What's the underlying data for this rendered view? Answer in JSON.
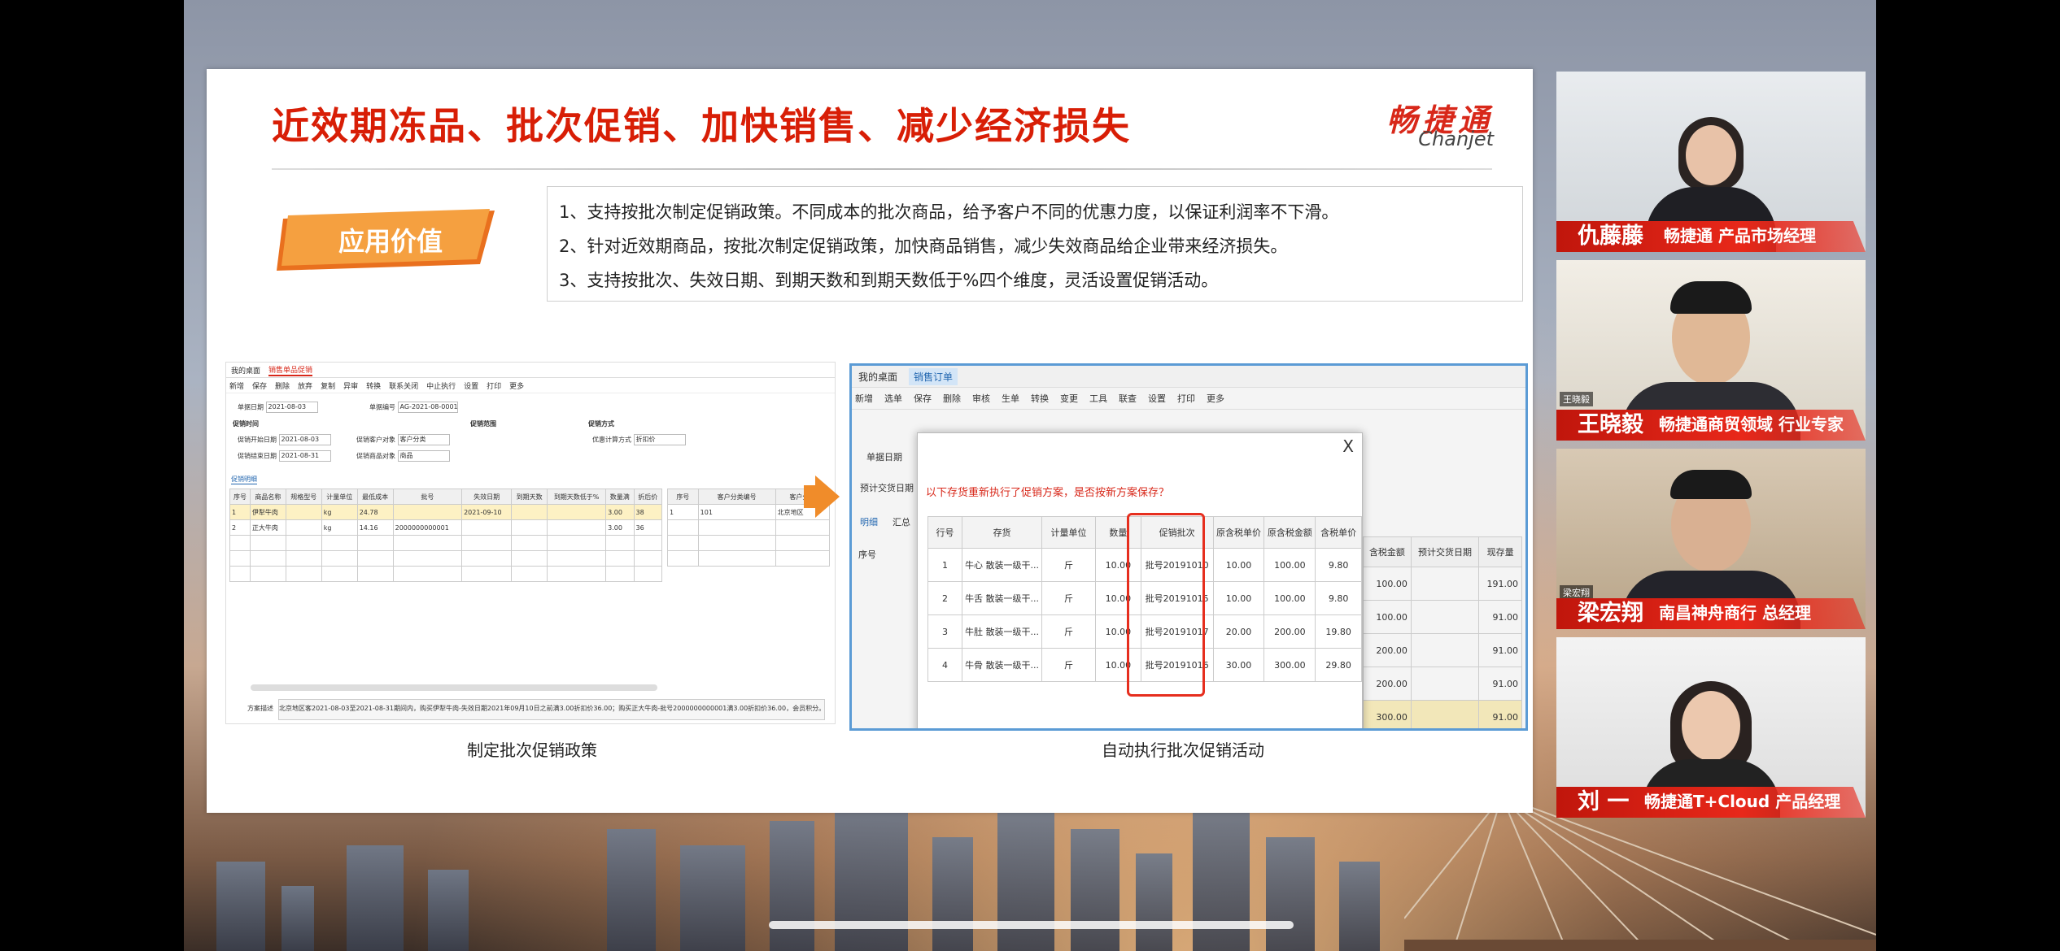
{
  "slide": {
    "title": "近效期冻品、批次促销、加快销售、减少经济损失",
    "logo_cn": "畅捷通",
    "logo_en": "Chanjet",
    "badge": "应用价值",
    "points": [
      "1、支持按批次制定促销政策。不同成本的批次商品，给予客户不同的优惠力度，以保证利润率不下滑。",
      "2、针对近效期商品，按批次制定促销政策，加快商品销售，减少失效商品给企业带来经济损失。",
      "3、支持按批次、失效日期、到期天数和到期天数低于%四个维度，灵活设置促销活动。"
    ],
    "caption_left": "制定批次促销政策",
    "caption_right": "自动执行批次促销活动"
  },
  "left_shot": {
    "tabs": [
      "我的桌面",
      "销售单品促销"
    ],
    "toolbar": [
      "新增",
      "保存",
      "删除",
      "放弃",
      "复制",
      "异审",
      "转换",
      "联系关闭",
      "中止执行",
      "设置",
      "打印",
      "更多"
    ],
    "form": {
      "date_label": "单据日期",
      "date_value": "2021-08-03",
      "code_label": "单据编号",
      "code_value": "AG-2021-08-0001",
      "sec_time": "促销时间",
      "sec_scope": "促销范围",
      "sec_method": "促销方式",
      "start_label": "促销开始日期",
      "start_value": "2021-08-03",
      "end_label": "促销结束日期",
      "end_value": "2021-08-31",
      "cust_label": "促销客户对象",
      "cust_value": "客户分类",
      "goods_label": "促销商品对象",
      "goods_value": "商品",
      "calc_label": "优惠计算方式",
      "calc_value": "折扣价",
      "section_detail": "促销明细"
    },
    "columns": [
      "序号",
      "商品名称",
      "规格型号",
      "计量单位",
      "最低成本",
      "批号",
      "失效日期",
      "到期天数",
      "到期天数低于%",
      "数量满",
      "折后价"
    ],
    "rows": [
      [
        "1",
        "伊犁牛肉",
        "",
        "kg",
        "24.78",
        "",
        "2021-09-10",
        "",
        "",
        "3.00",
        "38"
      ],
      [
        "2",
        "正大牛肉",
        "",
        "kg",
        "14.16",
        "2000000000001",
        "",
        "",
        "",
        "3.00",
        "36"
      ]
    ],
    "right_columns": [
      "序号",
      "客户分类编号",
      "客户分类"
    ],
    "right_rows": [
      [
        "1",
        "101",
        "北京地区"
      ]
    ],
    "remark_label": "方案描述",
    "remark": "北京地区客2021-08-03至2021-08-31期间内，购买伊犁牛肉-失效日期2021年09月10日之前满3.00折扣价36.00；购买正大牛肉-批号2000000000001满3.00折扣价36.00，会员积分。"
  },
  "right_shot": {
    "tabs": [
      "我的桌面",
      "销售订单"
    ],
    "toolbar": [
      "新增",
      "选单",
      "保存",
      "删除",
      "审核",
      "生单",
      "转换",
      "变更",
      "工具",
      "联查",
      "设置",
      "打印",
      "更多"
    ],
    "dialog": {
      "message": "以下存货重新执行了促销方案，是否按新方案保存？",
      "columns": [
        "行号",
        "存货",
        "计量单位",
        "数量",
        "促销批次",
        "原含税单价",
        "原含税金额",
        "含税单价"
      ],
      "rows": [
        [
          "1",
          "牛心 散装一级干...",
          "斤",
          "10.00",
          "批号20191010",
          "10.00",
          "100.00",
          "9.80"
        ],
        [
          "2",
          "牛舌 散装一级干...",
          "斤",
          "10.00",
          "批号20191015",
          "10.00",
          "100.00",
          "9.80"
        ],
        [
          "3",
          "牛肚 散装一级干...",
          "斤",
          "10.00",
          "批号20191017",
          "20.00",
          "200.00",
          "19.80"
        ],
        [
          "4",
          "牛骨 散装一级干...",
          "斤",
          "10.00",
          "批号20191016",
          "30.00",
          "300.00",
          "29.80"
        ]
      ],
      "close": "X"
    },
    "grid_columns": [
      "含税金额",
      "预计交货日期",
      "现存量"
    ],
    "grid_rows": [
      [
        "100.00",
        "",
        "191.00"
      ],
      [
        "100.00",
        "",
        "91.00"
      ],
      [
        "200.00",
        "",
        "91.00"
      ],
      [
        "200.00",
        "",
        "91.00"
      ],
      [
        "300.00",
        "",
        "91.00"
      ]
    ],
    "side_labels": [
      "单据日期",
      "预计交货日期",
      "明细",
      "汇总",
      "序号"
    ]
  },
  "participants": [
    {
      "name": "仇藤藤",
      "role": "畅捷通 产品市场经理",
      "tag": ""
    },
    {
      "name": "王晓毅",
      "role": "畅捷通商贸领域 行业专家",
      "tag": "王晓毅"
    },
    {
      "name": "梁宏翔",
      "role": "南昌神舟商行 总经理",
      "tag": "梁宏翔"
    },
    {
      "name": "刘 一",
      "role": "畅捷通T+Cloud 产品经理",
      "tag": ""
    }
  ],
  "colors": {
    "brand_red": "#d81e06",
    "badge_orange": "#f08c2a",
    "highlight_box": "#e62e1e"
  }
}
